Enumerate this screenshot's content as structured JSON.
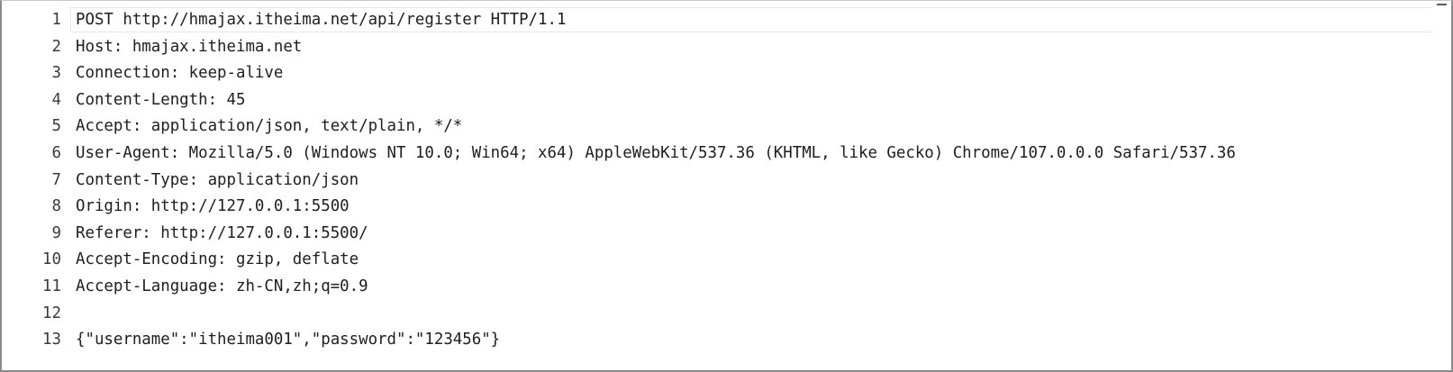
{
  "editor": {
    "lines": [
      {
        "number": "1",
        "text": "POST http://hmajax.itheima.net/api/register HTTP/1.1"
      },
      {
        "number": "2",
        "text": "Host: hmajax.itheima.net"
      },
      {
        "number": "3",
        "text": "Connection: keep-alive"
      },
      {
        "number": "4",
        "text": "Content-Length: 45"
      },
      {
        "number": "5",
        "text": "Accept: application/json, text/plain, */*"
      },
      {
        "number": "6",
        "text": "User-Agent: Mozilla/5.0 (Windows NT 10.0; Win64; x64) AppleWebKit/537.36 (KHTML, like Gecko) Chrome/107.0.0.0 Safari/537.36"
      },
      {
        "number": "7",
        "text": "Content-Type: application/json"
      },
      {
        "number": "8",
        "text": "Origin: http://127.0.0.1:5500"
      },
      {
        "number": "9",
        "text": "Referer: http://127.0.0.1:5500/"
      },
      {
        "number": "10",
        "text": "Accept-Encoding: gzip, deflate"
      },
      {
        "number": "11",
        "text": "Accept-Language: zh-CN,zh;q=0.9"
      },
      {
        "number": "12",
        "text": ""
      },
      {
        "number": "13",
        "text": "{\"username\":\"itheima001\",\"password\":\"123456\"}"
      }
    ],
    "current_line": 1
  },
  "icons": {
    "scrollbar": "scrollbar-thumb-icon"
  }
}
